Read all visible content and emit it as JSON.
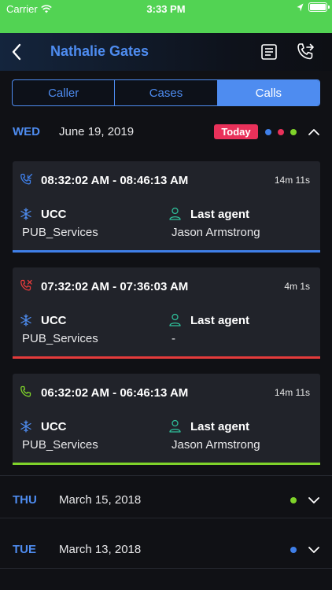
{
  "status_bar": {
    "carrier": "Carrier",
    "time": "3:33 PM"
  },
  "header": {
    "title": "Nathalie Gates"
  },
  "tabs": [
    {
      "label": "Caller",
      "active": false
    },
    {
      "label": "Cases",
      "active": false
    },
    {
      "label": "Calls",
      "active": true
    }
  ],
  "days": [
    {
      "day": "WED",
      "date": "June 19, 2019",
      "badge": "Today",
      "dots": [
        "#3f7fe8",
        "#e9315a",
        "#7fd32a"
      ],
      "expanded": true,
      "calls": [
        {
          "status": "incoming",
          "color": "#3f7fe8",
          "time_range": "08:32:02 AM - 08:46:13 AM",
          "duration": "14m 11s",
          "queue_label": "UCC",
          "queue": "PUB_Services",
          "agent_label": "Last agent",
          "agent": "Jason Armstrong"
        },
        {
          "status": "missed",
          "color": "#e53b3b",
          "time_range": "07:32:02 AM - 07:36:03 AM",
          "duration": "4m 1s",
          "queue_label": "UCC",
          "queue": "PUB_Services",
          "agent_label": "Last agent",
          "agent": "-"
        },
        {
          "status": "completed",
          "color": "#7fd32a",
          "time_range": "06:32:02 AM - 06:46:13 AM",
          "duration": "14m 11s",
          "queue_label": "UCC",
          "queue": "PUB_Services",
          "agent_label": "Last agent",
          "agent": "Jason Armstrong"
        }
      ]
    },
    {
      "day": "THU",
      "date": "March 15, 2018",
      "dots": [
        "#7fd32a"
      ],
      "expanded": false
    },
    {
      "day": "TUE",
      "date": "March 13, 2018",
      "dots": [
        "#3f7fe8"
      ],
      "expanded": false
    }
  ],
  "icons": {
    "back": "chevron-left-icon",
    "notes": "document-icon",
    "transfer": "phone-forward-icon",
    "queue": "snowflake-icon",
    "agent": "person-icon",
    "collapse": "chevron-up-icon",
    "expand": "chevron-down-icon"
  }
}
